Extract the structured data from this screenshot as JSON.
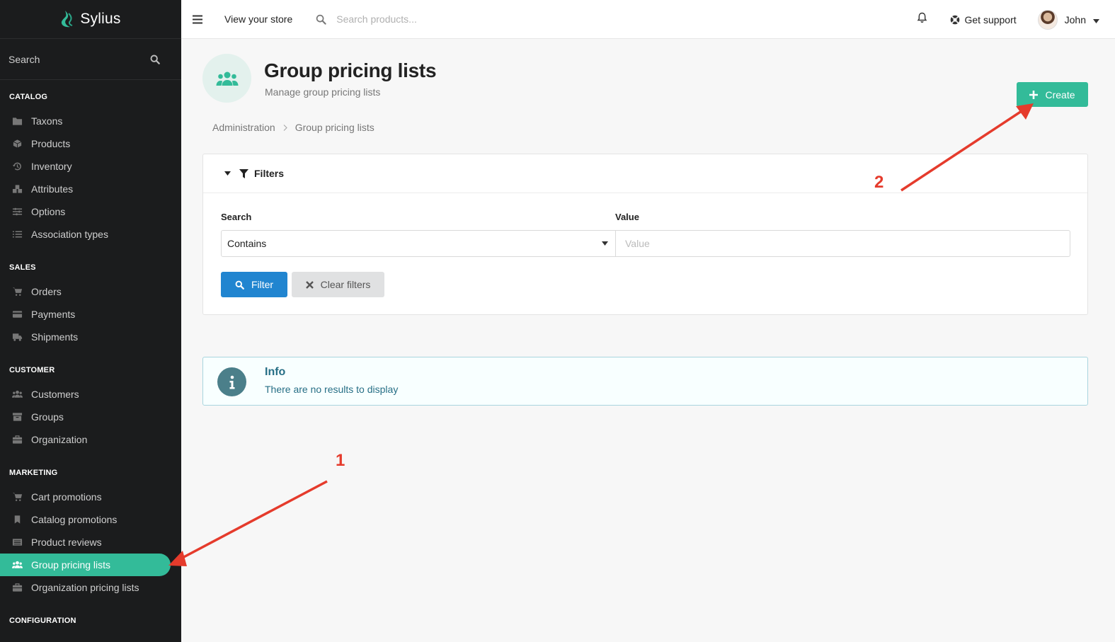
{
  "brand": {
    "name": "Sylius",
    "accent": "#33bb99"
  },
  "sidebar": {
    "search_label": "Search",
    "sections": [
      {
        "title": "CATALOG",
        "items": [
          {
            "label": "Taxons",
            "icon": "folder-icon"
          },
          {
            "label": "Products",
            "icon": "cube-icon"
          },
          {
            "label": "Inventory",
            "icon": "history-icon"
          },
          {
            "label": "Attributes",
            "icon": "cubes-icon"
          },
          {
            "label": "Options",
            "icon": "options-icon"
          },
          {
            "label": "Association types",
            "icon": "tasks-icon"
          }
        ]
      },
      {
        "title": "SALES",
        "items": [
          {
            "label": "Orders",
            "icon": "cart-icon"
          },
          {
            "label": "Payments",
            "icon": "payment-icon"
          },
          {
            "label": "Shipments",
            "icon": "truck-icon"
          }
        ]
      },
      {
        "title": "CUSTOMER",
        "items": [
          {
            "label": "Customers",
            "icon": "users-icon"
          },
          {
            "label": "Groups",
            "icon": "archive-icon"
          },
          {
            "label": "Organization",
            "icon": "briefcase-icon"
          }
        ]
      },
      {
        "title": "MARKETING",
        "items": [
          {
            "label": "Cart promotions",
            "icon": "cart-promo-icon"
          },
          {
            "label": "Catalog promotions",
            "icon": "bookmark-icon"
          },
          {
            "label": "Product reviews",
            "icon": "newspaper-icon"
          },
          {
            "label": "Group pricing lists",
            "icon": "users-icon",
            "active": true
          },
          {
            "label": "Organization pricing lists",
            "icon": "briefcase-icon"
          }
        ]
      },
      {
        "title": "CONFIGURATION",
        "items": []
      }
    ]
  },
  "topbar": {
    "view_store": "View your store",
    "search_placeholder": "Search products...",
    "support": "Get support",
    "user": "John"
  },
  "page": {
    "title": "Group pricing lists",
    "subtitle": "Manage group pricing lists",
    "create_label": "Create",
    "breadcrumb": [
      "Administration",
      "Group pricing lists"
    ]
  },
  "filters": {
    "title": "Filters",
    "search_label": "Search",
    "value_label": "Value",
    "search_mode": "Contains",
    "value_placeholder": "Value",
    "filter_button": "Filter",
    "clear_button": "Clear filters"
  },
  "info": {
    "title": "Info",
    "message": "There are no results to display"
  },
  "annotations": [
    {
      "label": "1",
      "color": "#e53b2c"
    },
    {
      "label": "2",
      "color": "#e53b2c"
    }
  ]
}
